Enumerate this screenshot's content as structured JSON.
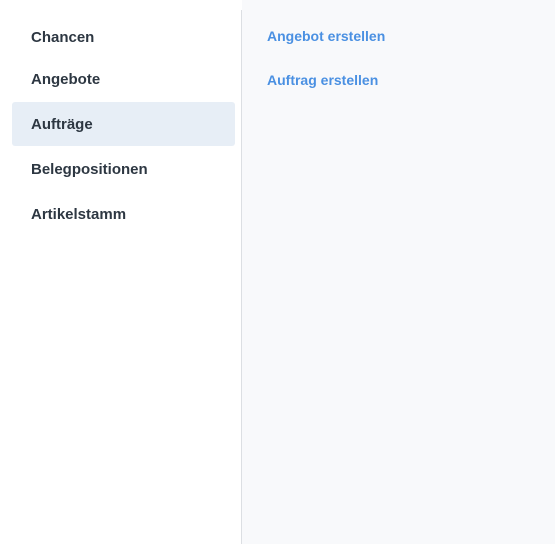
{
  "sidebar": {
    "items": [
      {
        "label": "Chancen",
        "active": false
      },
      {
        "label": "Angebote",
        "active": false
      },
      {
        "label": "Aufträge",
        "active": true
      },
      {
        "label": "Belegpositionen",
        "active": false
      },
      {
        "label": "Artikelstamm",
        "active": false
      }
    ]
  },
  "actions": {
    "items": [
      {
        "label": "Angebot erstellen"
      },
      {
        "label": "Auftrag erstellen"
      }
    ]
  },
  "colors": {
    "active_background": "#e7eef6",
    "link": "#4a90e2",
    "menu_text": "#2d3742",
    "action_panel_background": "#f8f9fb",
    "divider": "#dcdfe3"
  }
}
